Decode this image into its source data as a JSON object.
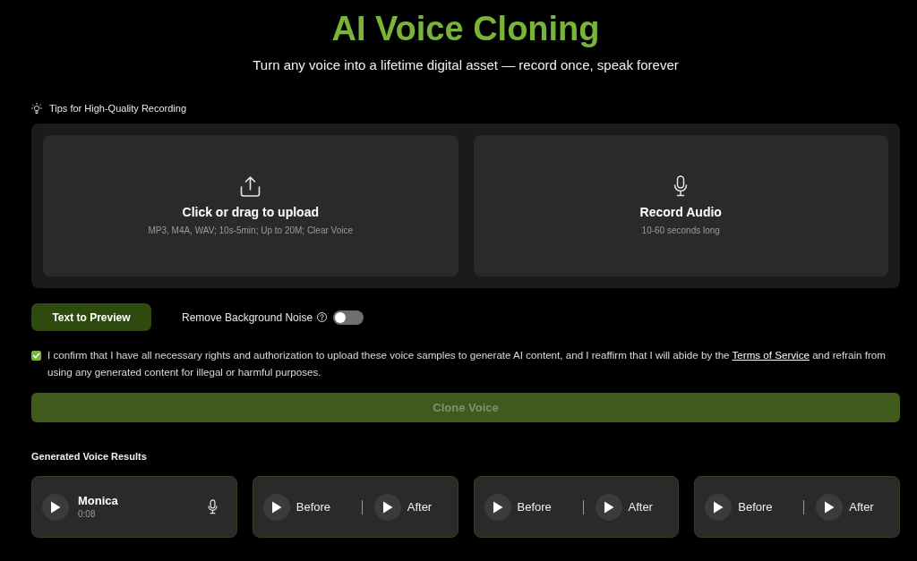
{
  "header": {
    "title": "AI Voice Cloning",
    "subtitle": "Turn any voice into a lifetime digital asset — record once, speak forever"
  },
  "tips": {
    "label": "Tips for High-Quality Recording"
  },
  "sources": [
    {
      "kind": "upload",
      "title": "Click or drag to upload",
      "hint": "MP3, M4A, WAV; 10s-5min; Up to 20M; Clear Voice"
    },
    {
      "kind": "record",
      "title": "Record Audio",
      "hint": "10-60 seconds long"
    }
  ],
  "preview_button": {
    "label": "Text to Preview"
  },
  "noise_removal": {
    "label": "Remove Background Noise",
    "on": false
  },
  "consent": {
    "checked": true,
    "text_before": "I confirm that I have all necessary rights and authorization to upload these voice samples to generate AI content, and I reaffirm that I will abide by the",
    "link": "Terms of Service",
    "text_after": "and refrain from using any generated content for illegal or harmful purposes."
  },
  "clone_button": {
    "label": "Clone Voice",
    "disabled": true
  },
  "results": {
    "title": "Generated Voice Results",
    "items": [
      {
        "kind": "voice",
        "name": "Monica",
        "duration": "0:08"
      },
      {
        "kind": "comparison",
        "before": "Before",
        "after": "After"
      },
      {
        "kind": "comparison",
        "before": "Before",
        "after": "After"
      },
      {
        "kind": "comparison",
        "before": "Before",
        "after": "After"
      }
    ]
  }
}
